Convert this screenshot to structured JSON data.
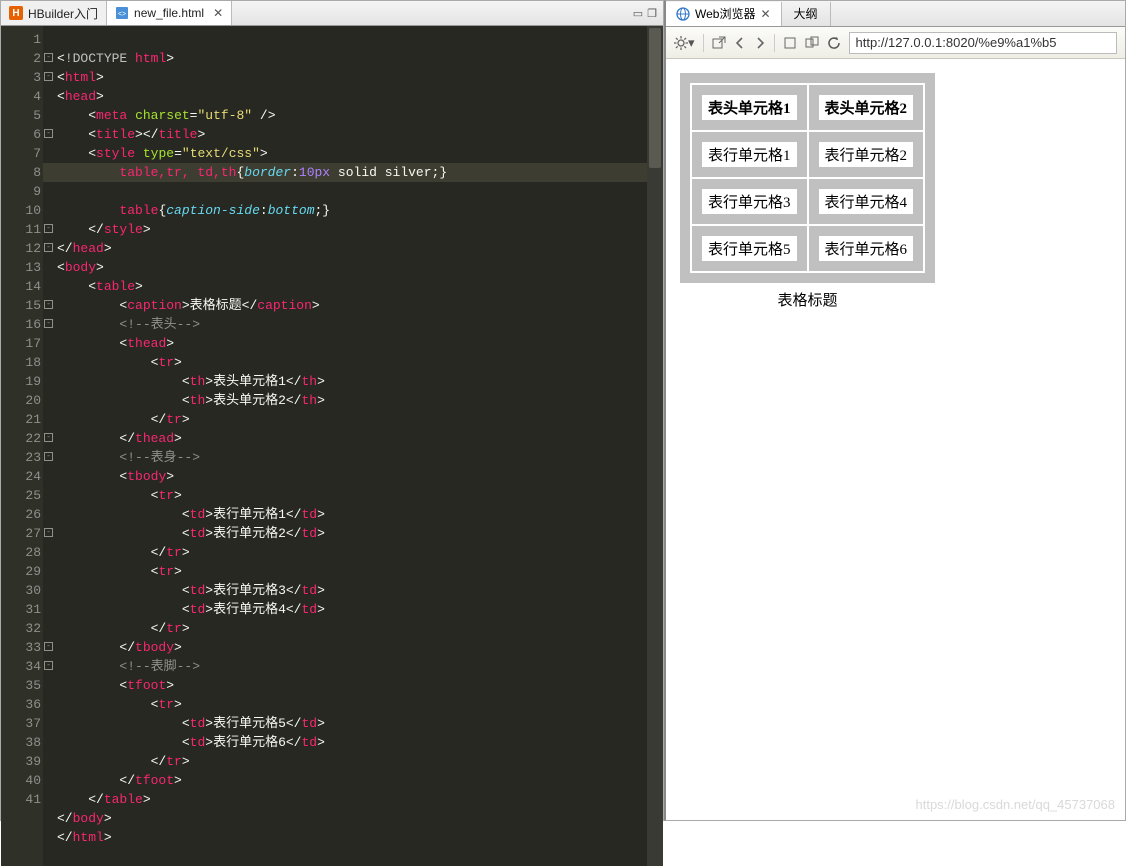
{
  "leftTabs": {
    "tab1": {
      "label": "HBuilder入门"
    },
    "tab2": {
      "label": "new_file.html"
    }
  },
  "winIcons": {
    "restore": "❐",
    "min": "▭"
  },
  "code": {
    "l1": {
      "doctype": "!DOCTYPE",
      "kw": "html"
    },
    "l2o": "html",
    "l2c": "html",
    "l3o": "head",
    "l3c": "head",
    "l4": {
      "tag": "meta",
      "attr": "charset",
      "val": "\"utf-8\""
    },
    "l5": {
      "tag": "title"
    },
    "l6": {
      "tag": "style",
      "attr": "type",
      "val": "\"text/css\""
    },
    "l7": {
      "sel": "table,tr, td,th",
      "prop": "border",
      "num": "10px",
      "rest": "solid silver;"
    },
    "l8": {
      "sel": "table",
      "prop": "caption-side",
      "val": "bottom"
    },
    "l9c": "style",
    "l10c": "head",
    "l11o": "body",
    "l11c": "body",
    "l12o": "table",
    "l12c": "table",
    "l13": {
      "tag": "caption",
      "text": "表格标题"
    },
    "l14c": "<!--表头-->",
    "l15o": "thead",
    "l15c": "thead",
    "l16o": "tr",
    "l16c": "tr",
    "l17": {
      "tag": "th",
      "text": "表头单元格1"
    },
    "l18": {
      "tag": "th",
      "text": "表头单元格2"
    },
    "l21c": "<!--表身-->",
    "l22o": "tbody",
    "l22c": "tbody",
    "l24": {
      "tag": "td",
      "text": "表行单元格1"
    },
    "l25": {
      "tag": "td",
      "text": "表行单元格2"
    },
    "l28": {
      "tag": "td",
      "text": "表行单元格3"
    },
    "l29": {
      "tag": "td",
      "text": "表行单元格4"
    },
    "l32c": "<!--表脚-->",
    "l33o": "tfoot",
    "l33c": "tfoot",
    "l35": {
      "tag": "td",
      "text": "表行单元格5"
    },
    "l36": {
      "tag": "td",
      "text": "表行单元格6"
    }
  },
  "lineNumbers": [
    "1",
    "2",
    "3",
    "4",
    "5",
    "6",
    "7",
    "8",
    "9",
    "10",
    "11",
    "12",
    "13",
    "14",
    "15",
    "16",
    "17",
    "18",
    "19",
    "20",
    "21",
    "22",
    "23",
    "24",
    "25",
    "26",
    "27",
    "28",
    "29",
    "30",
    "31",
    "32",
    "33",
    "34",
    "35",
    "36",
    "37",
    "38",
    "39",
    "40",
    "41"
  ],
  "foldLines": [
    2,
    3,
    6,
    11,
    12,
    15,
    16,
    22,
    23,
    27,
    33,
    34
  ],
  "rightTabs": {
    "tab1": "Web浏览器",
    "tab2": "大纲"
  },
  "url": "http://127.0.0.1:8020/%e9%a1%b5",
  "preview": {
    "caption": "表格标题",
    "th1": "表头单元格1",
    "th2": "表头单元格2",
    "r1c1": "表行单元格1",
    "r1c2": "表行单元格2",
    "r2c1": "表行单元格3",
    "r2c2": "表行单元格4",
    "r3c1": "表行单元格5",
    "r3c2": "表行单元格6"
  },
  "watermark": "https://blog.csdn.net/qq_45737068"
}
